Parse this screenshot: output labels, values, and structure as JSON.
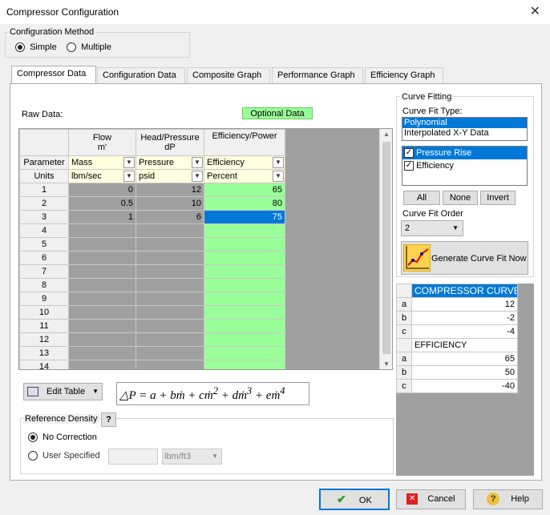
{
  "window": {
    "title": "Compressor Configuration"
  },
  "config_method": {
    "label": "Configuration Method",
    "simple": "Simple",
    "multiple": "Multiple"
  },
  "tabs": [
    "Compressor Data",
    "Configuration Data",
    "Composite Graph",
    "Performance Graph",
    "Efficiency Graph"
  ],
  "raw_data": {
    "label": "Raw Data:",
    "optional": "Optional Data"
  },
  "grid": {
    "col_headers": [
      [
        "Flow",
        "m'"
      ],
      [
        "Head/Pressure",
        "dP"
      ],
      [
        "Efficiency/Power",
        ""
      ]
    ],
    "param_label": "Parameter",
    "units_label": "Units",
    "parameters": [
      "Mass",
      "Pressure",
      "Efficiency"
    ],
    "units": [
      "lbm/sec",
      "psid",
      "Percent"
    ],
    "rows": [
      {
        "n": "1",
        "flow": "0",
        "dp": "12",
        "eff": "65"
      },
      {
        "n": "2",
        "flow": "0.5",
        "dp": "10",
        "eff": "80"
      },
      {
        "n": "3",
        "flow": "1",
        "dp": "6",
        "eff": "75"
      },
      {
        "n": "4",
        "flow": "",
        "dp": "",
        "eff": ""
      },
      {
        "n": "5",
        "flow": "",
        "dp": "",
        "eff": ""
      },
      {
        "n": "6",
        "flow": "",
        "dp": "",
        "eff": ""
      },
      {
        "n": "7",
        "flow": "",
        "dp": "",
        "eff": ""
      },
      {
        "n": "8",
        "flow": "",
        "dp": "",
        "eff": ""
      },
      {
        "n": "9",
        "flow": "",
        "dp": "",
        "eff": ""
      },
      {
        "n": "10",
        "flow": "",
        "dp": "",
        "eff": ""
      },
      {
        "n": "11",
        "flow": "",
        "dp": "",
        "eff": ""
      },
      {
        "n": "12",
        "flow": "",
        "dp": "",
        "eff": ""
      },
      {
        "n": "13",
        "flow": "",
        "dp": "",
        "eff": ""
      },
      {
        "n": "14",
        "flow": "",
        "dp": "",
        "eff": ""
      }
    ]
  },
  "edit_table": "Edit Table",
  "reference_density": {
    "label": "Reference Density",
    "help": "?",
    "no_correction": "No Correction",
    "user_specified": "User Specified",
    "unit": "lbm/ft3"
  },
  "curve_fitting": {
    "label": "Curve Fitting",
    "type_label": "Curve Fit Type:",
    "types": [
      "Polynomial",
      "Interpolated X-Y Data"
    ],
    "items": [
      "Pressure Rise",
      "Efficiency"
    ],
    "all": "All",
    "none": "None",
    "invert": "Invert",
    "order_label": "Curve Fit Order",
    "order": "2",
    "generate": "Generate Curve Fit Now"
  },
  "results": {
    "compressor_header": "COMPRESSOR CURVE",
    "compressor": [
      {
        "k": "a",
        "v": "12"
      },
      {
        "k": "b",
        "v": "-2"
      },
      {
        "k": "c",
        "v": "-4"
      }
    ],
    "efficiency_header": "EFFICIENCY",
    "efficiency": [
      {
        "k": "a",
        "v": "65"
      },
      {
        "k": "b",
        "v": "50"
      },
      {
        "k": "c",
        "v": "-40"
      }
    ]
  },
  "buttons": {
    "ok": "OK",
    "cancel": "Cancel",
    "help": "Help"
  }
}
